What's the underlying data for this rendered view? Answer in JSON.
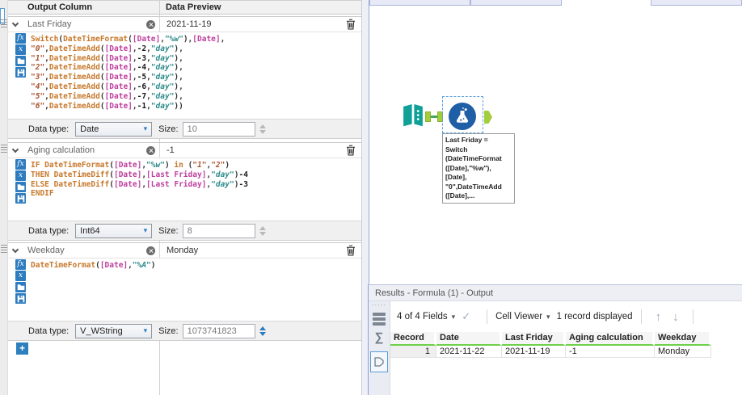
{
  "colors": {
    "accent_blue": "#2E7CC0",
    "tool_teal": "#0FA097",
    "tool_blue": "#1E5FA6",
    "anchor_green": "#A3CE3C",
    "connection_green": "#45A75E",
    "result_header_green": "#6ED04A",
    "selection_dash_blue": "#5AA2E0"
  },
  "icons": {
    "caret_down": "▾",
    "check": "✓",
    "arrow_up": "↑",
    "arrow_down": "↓",
    "sigma": "∑",
    "plus": "+",
    "fx": "fx",
    "x_var": "x",
    "grip_dots": "·····"
  },
  "config": {
    "header": {
      "output_column": "Output Column",
      "data_preview": "Data Preview"
    },
    "data_type_label": "Data type:",
    "size_label": "Size:",
    "expressions": [
      {
        "name": "Last Friday",
        "preview": "2021-11-19",
        "data_type": "Date",
        "size": "10",
        "size_enabled": false,
        "code": [
          [
            [
              "fn",
              "Switch"
            ],
            [
              "p",
              "("
            ],
            [
              "fn",
              "DateTimeFormat"
            ],
            [
              "p",
              "("
            ],
            [
              "col",
              "[Date]"
            ],
            [
              "p",
              ","
            ],
            [
              "str",
              "\"%w\""
            ],
            [
              "p",
              "),"
            ],
            [
              "col",
              "[Date]"
            ],
            [
              "p",
              ","
            ]
          ],
          [
            [
              "nstr",
              "\"0\""
            ],
            [
              "p",
              ","
            ],
            [
              "fn",
              "DateTimeAdd"
            ],
            [
              "p",
              "("
            ],
            [
              "col",
              "[Date]"
            ],
            [
              "p",
              ","
            ],
            [
              "num",
              "-2"
            ],
            [
              "p",
              ","
            ],
            [
              "str",
              "\"day\""
            ],
            [
              "p",
              "),"
            ]
          ],
          [
            [
              "nstr",
              "\"1\""
            ],
            [
              "p",
              ","
            ],
            [
              "fn",
              "DateTimeAdd"
            ],
            [
              "p",
              "("
            ],
            [
              "col",
              "[Date]"
            ],
            [
              "p",
              ","
            ],
            [
              "num",
              "-3"
            ],
            [
              "p",
              ","
            ],
            [
              "str",
              "\"day\""
            ],
            [
              "p",
              "),"
            ]
          ],
          [
            [
              "nstr",
              "\"2\""
            ],
            [
              "p",
              ","
            ],
            [
              "fn",
              "DateTimeAdd"
            ],
            [
              "p",
              "("
            ],
            [
              "col",
              "[Date]"
            ],
            [
              "p",
              ","
            ],
            [
              "num",
              "-4"
            ],
            [
              "p",
              ","
            ],
            [
              "str",
              "\"day\""
            ],
            [
              "p",
              "),"
            ]
          ],
          [
            [
              "nstr",
              "\"3\""
            ],
            [
              "p",
              ","
            ],
            [
              "fn",
              "DateTimeAdd"
            ],
            [
              "p",
              "("
            ],
            [
              "col",
              "[Date]"
            ],
            [
              "p",
              ","
            ],
            [
              "num",
              "-5"
            ],
            [
              "p",
              ","
            ],
            [
              "str",
              "\"day\""
            ],
            [
              "p",
              "),"
            ]
          ],
          [
            [
              "nstr",
              "\"4\""
            ],
            [
              "p",
              ","
            ],
            [
              "fn",
              "DateTimeAdd"
            ],
            [
              "p",
              "("
            ],
            [
              "col",
              "[Date]"
            ],
            [
              "p",
              ","
            ],
            [
              "num",
              "-6"
            ],
            [
              "p",
              ","
            ],
            [
              "str",
              "\"day\""
            ],
            [
              "p",
              "),"
            ]
          ],
          [
            [
              "nstr",
              "\"5\""
            ],
            [
              "p",
              ","
            ],
            [
              "fn",
              "DateTimeAdd"
            ],
            [
              "p",
              "("
            ],
            [
              "col",
              "[Date]"
            ],
            [
              "p",
              ","
            ],
            [
              "num",
              "-7"
            ],
            [
              "p",
              ","
            ],
            [
              "str",
              "\"day\""
            ],
            [
              "p",
              "),"
            ]
          ],
          [
            [
              "nstr",
              "\"6\""
            ],
            [
              "p",
              ","
            ],
            [
              "fn",
              "DateTimeAdd"
            ],
            [
              "p",
              "("
            ],
            [
              "col",
              "[Date]"
            ],
            [
              "p",
              ","
            ],
            [
              "num",
              "-1"
            ],
            [
              "p",
              ","
            ],
            [
              "str",
              "\"day\""
            ],
            [
              "p",
              "))"
            ]
          ]
        ]
      },
      {
        "name": "Aging calculation",
        "preview": "-1",
        "data_type": "Int64",
        "size": "8",
        "size_enabled": false,
        "code": [
          [
            [
              "kw",
              "IF "
            ],
            [
              "fn",
              "DateTimeFormat"
            ],
            [
              "p",
              "("
            ],
            [
              "col",
              "[Date]"
            ],
            [
              "p",
              ","
            ],
            [
              "str",
              "\"%w\""
            ],
            [
              "p",
              ") "
            ],
            [
              "kw",
              "in"
            ],
            [
              "p",
              " ("
            ],
            [
              "nstr",
              "\"1\""
            ],
            [
              "p",
              ","
            ],
            [
              "nstr",
              "\"2\""
            ],
            [
              "p",
              ")"
            ]
          ],
          [
            [
              "kw",
              "THEN "
            ],
            [
              "fn",
              "DateTimeDiff"
            ],
            [
              "p",
              "("
            ],
            [
              "col",
              "[Date]"
            ],
            [
              "p",
              ","
            ],
            [
              "col",
              "[Last Friday]"
            ],
            [
              "p",
              ","
            ],
            [
              "str",
              "\"day\""
            ],
            [
              "p",
              ")"
            ],
            [
              "num",
              "-4"
            ]
          ],
          [
            [
              "kw",
              "ELSE "
            ],
            [
              "fn",
              "DateTimeDiff"
            ],
            [
              "p",
              "("
            ],
            [
              "col",
              "[Date]"
            ],
            [
              "p",
              ","
            ],
            [
              "col",
              "[Last Friday]"
            ],
            [
              "p",
              ","
            ],
            [
              "str",
              "\"day\""
            ],
            [
              "p",
              ")"
            ],
            [
              "num",
              "-3"
            ]
          ],
          [
            [
              "kw",
              "ENDIF"
            ]
          ]
        ]
      },
      {
        "name": "Weekday",
        "preview": "Monday",
        "data_type": "V_WString",
        "size": "1073741823",
        "size_enabled": true,
        "code": [
          [
            [
              "fn",
              "DateTimeFormat"
            ],
            [
              "p",
              "("
            ],
            [
              "col",
              "[Date]"
            ],
            [
              "p",
              ","
            ],
            [
              "str",
              "\"%A\""
            ],
            [
              "p",
              ")"
            ]
          ]
        ]
      }
    ]
  },
  "canvas": {
    "annotation_lines": [
      "Last Friday =",
      "Switch",
      "(DateTimeFormat",
      "([Date],\"%w\"),",
      "[Date],",
      "\"0\",DateTimeAdd",
      "([Date],..."
    ]
  },
  "results": {
    "title": "Results - Formula (1) - Output",
    "toolbar": {
      "fields": "4 of 4 Fields",
      "cell_viewer": "Cell Viewer",
      "records": "1 record displayed"
    },
    "table": {
      "headers": [
        "Record",
        "Date",
        "Last Friday",
        "Aging calculation",
        "Weekday"
      ],
      "rows": [
        [
          "1",
          "2021-11-22",
          "2021-11-19",
          "-1",
          "Monday"
        ]
      ]
    }
  }
}
